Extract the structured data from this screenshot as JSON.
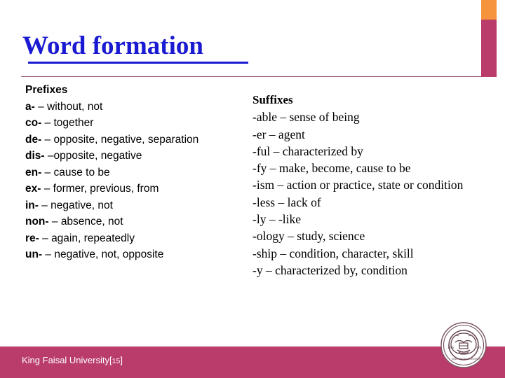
{
  "slide": {
    "title": "Word formation",
    "title_color": "#1A1AD2",
    "accent_orange": "#F5943C",
    "accent_magenta": "#B93C6B",
    "divider_color": "#8E4F68"
  },
  "prefixes": {
    "heading": "Prefixes",
    "items": [
      {
        "affix": "a-",
        "dash": " – ",
        "meaning": "without, not"
      },
      {
        "affix": "co-",
        "dash": " – ",
        "meaning": "together"
      },
      {
        "affix": "de-",
        "dash": " – ",
        "meaning": "opposite, negative, separation"
      },
      {
        "affix": "dis-",
        "dash": " –",
        "meaning": "opposite, negative"
      },
      {
        "affix": "en-",
        "dash": " – ",
        "meaning": "cause to be"
      },
      {
        "affix": "ex-",
        "dash": " – ",
        "meaning": "former, previous, from"
      },
      {
        "affix": "in-",
        "dash": " – ",
        "meaning": "negative, not"
      },
      {
        "affix": "non-",
        "dash": " – ",
        "meaning": "absence, not"
      },
      {
        "affix": "re-",
        "dash": " – ",
        "meaning": "again, repeatedly"
      },
      {
        "affix": "un-",
        "dash": " – ",
        "meaning": "negative, not, opposite"
      }
    ]
  },
  "suffixes": {
    "heading": "Suffixes",
    "items": [
      {
        "text": "-able – sense of being"
      },
      {
        "text": "-er – agent"
      },
      {
        "text": "-ful – characterized by"
      },
      {
        "text": "-fy – make, become, cause to be"
      },
      {
        "text": "-ism – action or practice, state or condition"
      },
      {
        "text": "-less – lack of"
      },
      {
        "text": "-ly – -like"
      },
      {
        "text": "-ology – study, science"
      },
      {
        "text": "-ship – condition, character, skill"
      },
      {
        "text": "-y – characterized by, condition"
      }
    ]
  },
  "footer": {
    "institution": "King Faisal University",
    "bracket_open": "[",
    "page_number": "15",
    "bracket_close": "]",
    "band_color": "#B93C6B",
    "text_color": "#FFFFFF",
    "seal_label": "king-faisal-university-seal"
  }
}
